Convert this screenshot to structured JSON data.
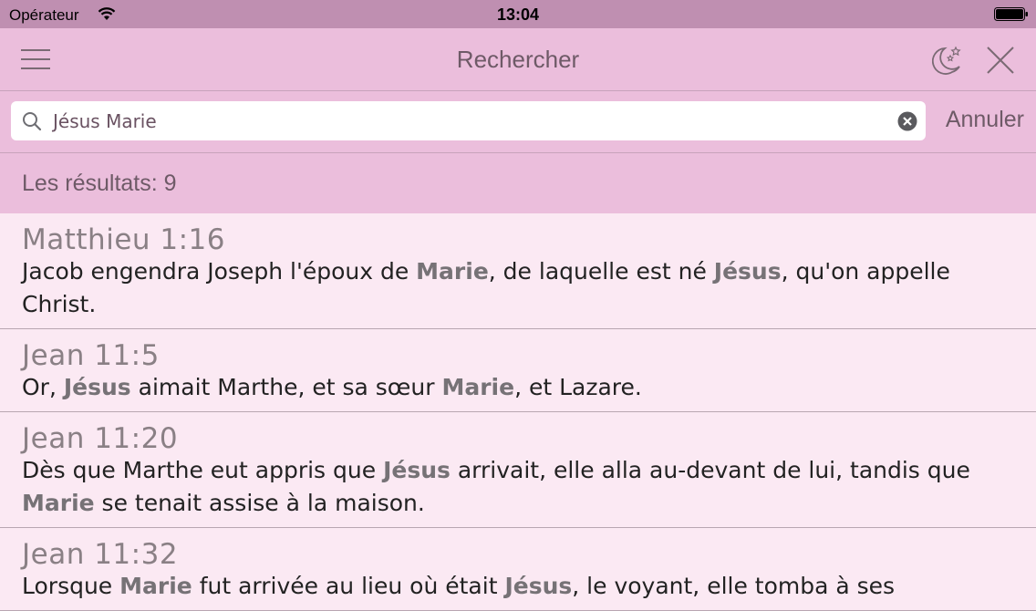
{
  "status": {
    "carrier": "Opérateur",
    "time": "13:04"
  },
  "nav": {
    "title": "Rechercher",
    "menu_icon": "hamburger-icon",
    "theme_icon": "moon-stars-icon",
    "close_icon": "close-icon"
  },
  "search": {
    "value": "Jésus Marie",
    "cancel_label": "Annuler"
  },
  "results": {
    "count_label": "Les résultats: 9",
    "items": [
      {
        "ref": "Matthieu 1:16",
        "parts": [
          {
            "t": "Jacob engendra Joseph l'époux de ",
            "hl": false
          },
          {
            "t": "Marie",
            "hl": true
          },
          {
            "t": ", de laquelle est né ",
            "hl": false
          },
          {
            "t": "Jésus",
            "hl": true
          },
          {
            "t": ", qu'on appelle Christ.",
            "hl": false
          }
        ]
      },
      {
        "ref": "Jean 11:5",
        "parts": [
          {
            "t": "Or, ",
            "hl": false
          },
          {
            "t": "Jésus",
            "hl": true
          },
          {
            "t": " aimait Marthe, et sa sœur ",
            "hl": false
          },
          {
            "t": "Marie",
            "hl": true
          },
          {
            "t": ", et Lazare.",
            "hl": false
          }
        ]
      },
      {
        "ref": "Jean 11:20",
        "parts": [
          {
            "t": "Dès que Marthe eut appris que ",
            "hl": false
          },
          {
            "t": "Jésus",
            "hl": true
          },
          {
            "t": " arrivait, elle alla au-devant de lui, tandis que ",
            "hl": false
          },
          {
            "t": "Marie",
            "hl": true
          },
          {
            "t": " se tenait assise à la maison.",
            "hl": false
          }
        ]
      },
      {
        "ref": "Jean 11:32",
        "parts": [
          {
            "t": "Lorsque ",
            "hl": false
          },
          {
            "t": "Marie",
            "hl": true
          },
          {
            "t": " fut arrivée au lieu où était ",
            "hl": false
          },
          {
            "t": "Jésus",
            "hl": true
          },
          {
            "t": ", le voyant, elle tomba à ses",
            "hl": false
          }
        ]
      }
    ]
  },
  "colors": {
    "statusbar": "#bf8fb1",
    "navbar": "#ebbedc",
    "list_bg": "#fbe9f3",
    "accent_text": "#6e5a67"
  }
}
